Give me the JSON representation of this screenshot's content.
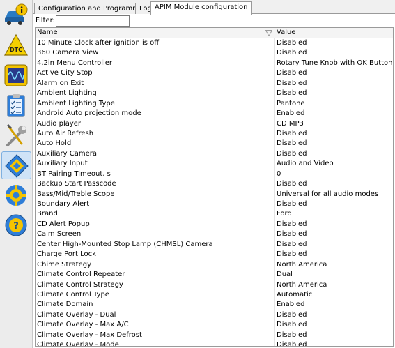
{
  "tabs": [
    {
      "label": "Configuration and Programming"
    },
    {
      "label": "Log"
    },
    {
      "label": "APIM Module configuration"
    }
  ],
  "filter": {
    "label": "Filter:",
    "value": ""
  },
  "columns": {
    "name": "Name",
    "value": "Value"
  },
  "sidebar": {
    "items": [
      {
        "icon": "car-info-icon"
      },
      {
        "icon": "dtc-icon",
        "text": "DTC"
      },
      {
        "icon": "oscilloscope-icon"
      },
      {
        "icon": "checklist-icon"
      },
      {
        "icon": "wrench-screwdriver-icon"
      },
      {
        "icon": "module-chip-icon",
        "active": true
      },
      {
        "icon": "settings-gear-icon"
      },
      {
        "icon": "help-icon",
        "text": "?"
      }
    ]
  },
  "rows": [
    {
      "name": "10 Minute Clock after ignition is off",
      "value": "Disabled"
    },
    {
      "name": "360 Camera View",
      "value": "Disabled"
    },
    {
      "name": "4.2in Menu Controller",
      "value": "Rotary Tune Knob with OK Button"
    },
    {
      "name": "Active City Stop",
      "value": "Disabled"
    },
    {
      "name": "Alarm on Exit",
      "value": "Disabled"
    },
    {
      "name": "Ambient Lighting",
      "value": "Disabled"
    },
    {
      "name": "Ambient Lighting Type",
      "value": "Pantone"
    },
    {
      "name": "Android Auto projection mode",
      "value": "Enabled"
    },
    {
      "name": "Audio player",
      "value": "CD MP3"
    },
    {
      "name": "Auto Air Refresh",
      "value": "Disabled"
    },
    {
      "name": "Auto Hold",
      "value": "Disabled"
    },
    {
      "name": "Auxiliary Camera",
      "value": "Disabled"
    },
    {
      "name": "Auxiliary Input",
      "value": "Audio and Video"
    },
    {
      "name": "BT Pairing Timeout, s",
      "value": "0"
    },
    {
      "name": "Backup Start Passcode",
      "value": "Disabled"
    },
    {
      "name": "Bass/Mid/Treble Scope",
      "value": "Universal for all audio modes"
    },
    {
      "name": "Boundary Alert",
      "value": "Disabled"
    },
    {
      "name": "Brand",
      "value": "Ford"
    },
    {
      "name": "CD Alert Popup",
      "value": "Disabled"
    },
    {
      "name": "Calm Screen",
      "value": "Disabled"
    },
    {
      "name": "Center High-Mounted Stop Lamp (CHMSL) Camera",
      "value": "Disabled"
    },
    {
      "name": "Charge Port Lock",
      "value": "Disabled"
    },
    {
      "name": "Chime Strategy",
      "value": "North America"
    },
    {
      "name": "Climate Control Repeater",
      "value": "Dual"
    },
    {
      "name": "Climate Control Strategy",
      "value": "North America"
    },
    {
      "name": "Climate Control Type",
      "value": "Automatic"
    },
    {
      "name": "Climate Domain",
      "value": "Enabled"
    },
    {
      "name": "Climate Overlay - Dual",
      "value": "Disabled"
    },
    {
      "name": "Climate Overlay - Max A/C",
      "value": "Disabled"
    },
    {
      "name": "Climate Overlay - Max Defrost",
      "value": "Disabled"
    },
    {
      "name": "Climate Overlay - Mode",
      "value": "Disabled"
    }
  ]
}
